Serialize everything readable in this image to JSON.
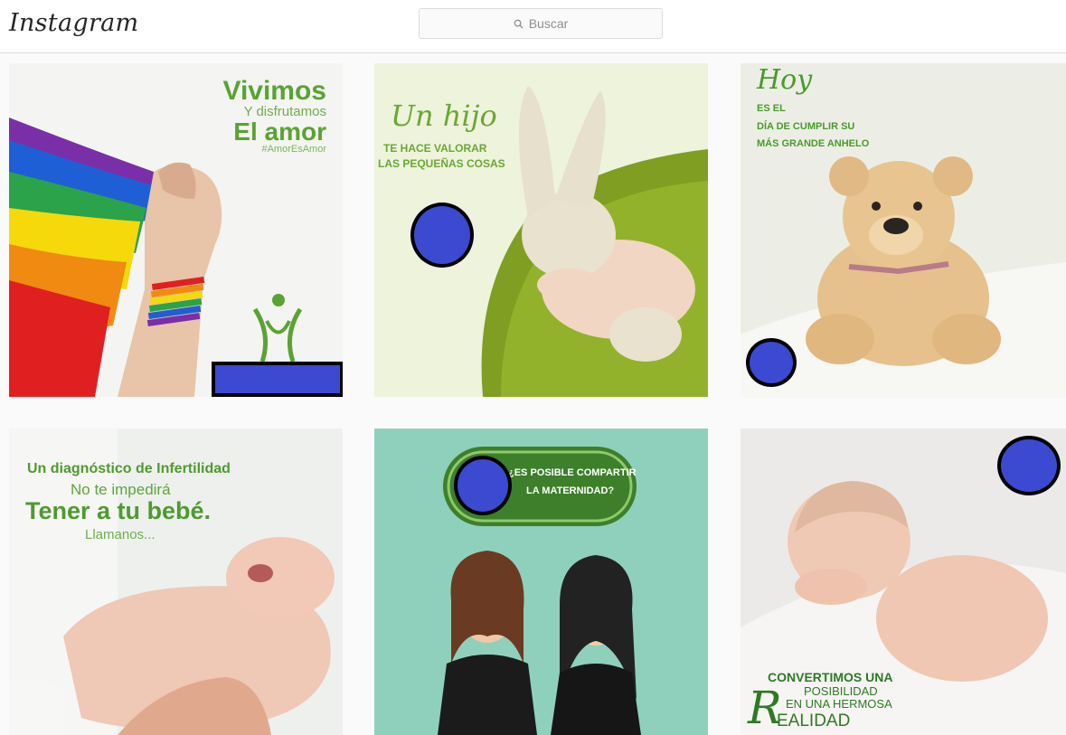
{
  "header": {
    "logo_text": "Instagram",
    "search": {
      "placeholder": "Buscar",
      "icon": "search-icon"
    }
  },
  "posts": [
    {
      "caption_lines": [
        "Vivimos",
        "Y disfrutamos",
        "El amor",
        "#AmorEsAmor"
      ],
      "colors": {
        "green": "#5aa332",
        "rainbow": [
          "#e02020",
          "#f08a10",
          "#f5d90a",
          "#2aa34a",
          "#1f5fd6",
          "#7a2fa8"
        ]
      }
    },
    {
      "caption_lines": [
        "Un hijo",
        "TE HACE VALORAR",
        "LAS PEQUEÑAS COSAS"
      ],
      "colors": {
        "green": "#6aa832",
        "bg": "#eef3dc"
      }
    },
    {
      "caption_lines": [
        "Hoy",
        "ES EL",
        "DÍA DE CUMPLIR SU",
        "MÁS GRANDE ANHELO"
      ],
      "colors": {
        "green": "#4a9a2a",
        "bg": "#eceee6"
      }
    },
    {
      "caption_lines": [
        "Un diagnóstico de Infertilidad",
        "No te impedirá",
        "Tener a tu bebé.",
        "Llamanos..."
      ],
      "colors": {
        "green": "#4e9b2e",
        "bg": "#eef0ee"
      }
    },
    {
      "caption_lines": [
        "¿ES POSIBLE COMPARTIR",
        "LA MATERNIDAD?"
      ],
      "colors": {
        "green": "#3d7f2a",
        "bg": "#8fd0bc"
      }
    },
    {
      "caption_lines": [
        "CONVERTIMOS UNA",
        "POSIBILIDAD",
        "EN UNA HERMOSA",
        "EALIDAD",
        "R"
      ],
      "colors": {
        "green": "#2e7a24",
        "bg": "#eceae8"
      }
    }
  ],
  "markers": {
    "fill": "#3b4ad0",
    "stroke": "#000000"
  }
}
